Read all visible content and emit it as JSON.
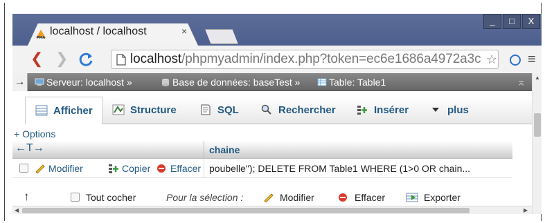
{
  "browser": {
    "tab_title": "localhost / localhost",
    "tab_close": "×",
    "url_host": "localhost",
    "url_rest": "/phpmyadmin/index.php?token=ec6e1686a4972a3c",
    "window_controls": [
      "_",
      "□",
      "X"
    ]
  },
  "breadcrumb": {
    "toggle": "→",
    "server_label": "Serveur: localhost »",
    "database_label": "Base de données: baseTest »",
    "table_label": "Table: Table1",
    "collapse": "⌅"
  },
  "tabs": [
    {
      "label": "Afficher",
      "icon": "table-browse-icon"
    },
    {
      "label": "Structure",
      "icon": "structure-icon"
    },
    {
      "label": "SQL",
      "icon": "sql-icon"
    },
    {
      "label": "Rechercher",
      "icon": "search-icon"
    },
    {
      "label": "Insérer",
      "icon": "insert-icon"
    },
    {
      "label": "plus",
      "icon": "chevron-down-icon"
    }
  ],
  "results": {
    "options_link": "+ Options",
    "sort_arrows": "←T→",
    "column_header": "chaine",
    "row": {
      "edit": "Modifier",
      "copy": "Copier",
      "delete": "Effacer",
      "value": "poubelle\"); DELETE FROM Table1 WHERE (1>0 OR chain..."
    }
  },
  "bulk": {
    "arrow": "↑",
    "check_all": "Tout cocher",
    "with_selected": "Pour la sélection :",
    "edit": "Modifier",
    "delete": "Effacer",
    "export": "Exporter"
  },
  "colors": {
    "link": "#235a81",
    "titlebar": "#5366a0",
    "delete_red": "#d83a2c"
  }
}
